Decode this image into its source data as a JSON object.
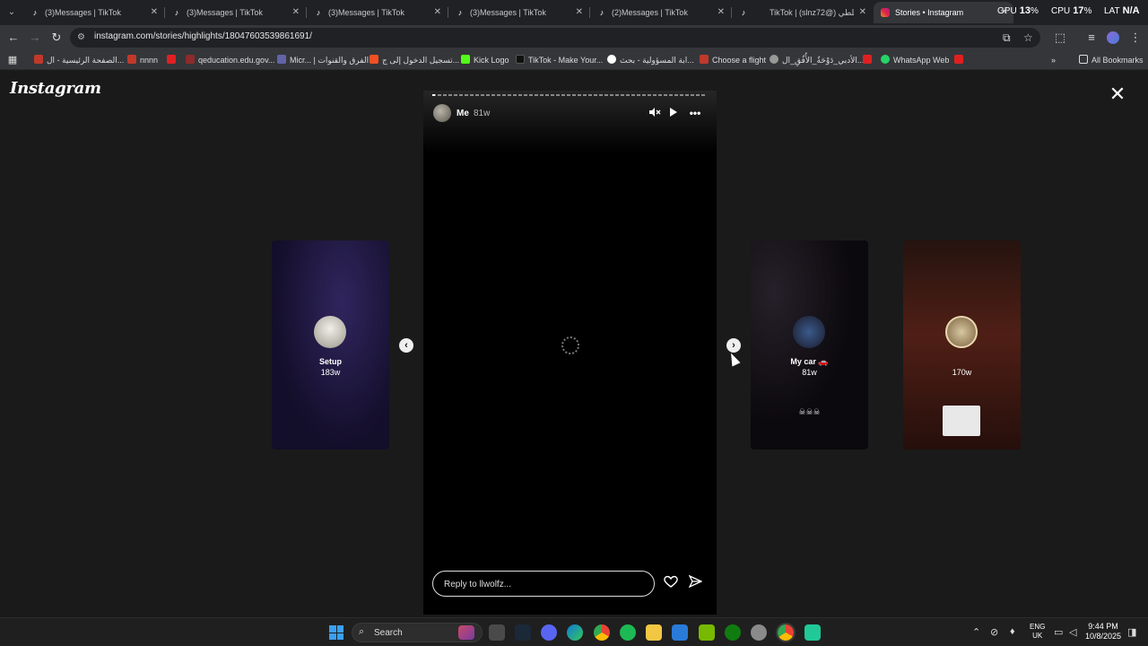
{
  "browser": {
    "tabs": [
      {
        "title": "(3)Messages | TikTok",
        "favicon": "tiktok-icon",
        "active": false
      },
      {
        "title": "(3)Messages | TikTok",
        "favicon": "tiktok-icon",
        "active": false
      },
      {
        "title": "(3)Messages | TikTok",
        "favicon": "tiktok-icon",
        "active": false
      },
      {
        "title": "(3)Messages | TikTok",
        "favicon": "tiktok-icon",
        "active": false
      },
      {
        "title": "(2)Messages | TikTok",
        "favicon": "tiktok-icon",
        "active": false
      },
      {
        "title": "TikTok | (slnz72@) السلطي",
        "favicon": "tiktok-icon",
        "active": false
      },
      {
        "title": "Stories • Instagram",
        "favicon": "instagram-icon",
        "active": true
      }
    ],
    "perf": {
      "gpu_label": "GPU",
      "gpu_value": "13",
      "cpu_label": "CPU",
      "cpu_value": "17",
      "lat_label": "LAT",
      "lat_value": "N/A",
      "pct": "%"
    },
    "url": "instagram.com/stories/highlights/18047603539861691/",
    "bookmarks": [
      {
        "label": "الصفحة الرئيسية - ال...",
        "color": "#c0392b"
      },
      {
        "label": "nnnn",
        "color": "#c0392b"
      },
      {
        "label": "",
        "color": "#e02020"
      },
      {
        "label": "qeducation.edu.gov...",
        "color": "#8e2b2b"
      },
      {
        "label": "Micr... | الفرق والقنوات",
        "color": "#6264a7"
      },
      {
        "label": "تسجيل الدخول إلى ج...",
        "color": "#f25022"
      },
      {
        "label": "Kick Logo",
        "color": "#53fc18"
      },
      {
        "label": "TikTok - Make Your...",
        "color": "#111111"
      },
      {
        "label": "ابة المسؤولية - بحث...",
        "color": "#4285f4"
      },
      {
        "label": "Choose a flight",
        "color": "#c0392b"
      },
      {
        "label": "الأدبي_دَوْحَةُ_الأُفُقِ_ال...",
        "color": "#999999"
      },
      {
        "label": "",
        "color": "#e02020"
      },
      {
        "label": "WhatsApp Web",
        "color": "#25d366"
      },
      {
        "label": "",
        "color": "#e02020"
      }
    ],
    "all_bookmarks_label": "All Bookmarks"
  },
  "instagram": {
    "logo": "Instagram",
    "story": {
      "username": "Me",
      "time": "81w",
      "reply_placeholder": "Reply to llwolfz...",
      "progress_fraction": 0.01
    },
    "highlights": [
      {
        "name": "Setup",
        "age": "183w"
      },
      {
        "name": "My car 🚗",
        "age": "81w"
      },
      {
        "name": "",
        "age": "170w"
      }
    ]
  },
  "taskbar": {
    "search_label": "Search",
    "lang_line1": "ENG",
    "lang_line2": "UK",
    "time": "9:44 PM",
    "date": "10/8/2025"
  }
}
